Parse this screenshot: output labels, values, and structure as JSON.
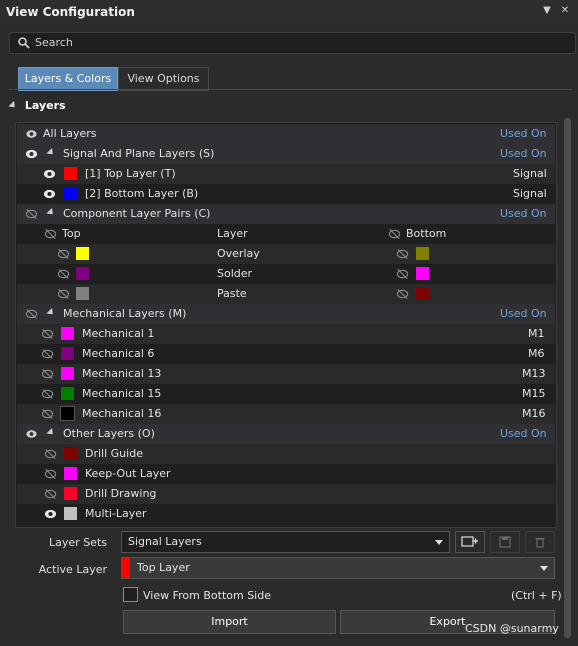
{
  "window": {
    "title": "View Configuration"
  },
  "search": {
    "placeholder": "Search"
  },
  "tabs": [
    {
      "label": "Layers & Colors"
    },
    {
      "label": "View Options"
    }
  ],
  "section": {
    "title": "Layers"
  },
  "groups": {
    "all": {
      "label": "All Layers",
      "status": "Used On"
    },
    "signal": {
      "label": "Signal And Plane Layers (S)",
      "status": "Used On",
      "rows": [
        {
          "name": "[1] Top Layer (T)",
          "value": "Signal",
          "color": "#ff0000"
        },
        {
          "name": "[2] Bottom Layer (B)",
          "value": "Signal",
          "color": "#0000ff"
        }
      ]
    },
    "pairs": {
      "label": "Component Layer Pairs (C)",
      "status": "Used On",
      "col_top": "Top",
      "col_layer": "Layer",
      "col_bottom": "Bottom",
      "rows": [
        {
          "layer": "Overlay",
          "top_color": "#ffff00",
          "bottom_color": "#808000"
        },
        {
          "layer": "Solder",
          "top_color": "#800080",
          "bottom_color": "#ff00ff"
        },
        {
          "layer": "Paste",
          "top_color": "#808080",
          "bottom_color": "#800000"
        }
      ]
    },
    "mech": {
      "label": "Mechanical Layers (M)",
      "status": "Used On",
      "rows": [
        {
          "name": "Mechanical 1",
          "value": "M1",
          "color": "#ff00ff"
        },
        {
          "name": "Mechanical 6",
          "value": "M6",
          "color": "#800080"
        },
        {
          "name": "Mechanical 13",
          "value": "M13",
          "color": "#ff00ff"
        },
        {
          "name": "Mechanical 15",
          "value": "M15",
          "color": "#008000"
        },
        {
          "name": "Mechanical 16",
          "value": "M16",
          "color": "#000000"
        }
      ]
    },
    "other": {
      "label": "Other Layers (O)",
      "status": "Used On",
      "rows": [
        {
          "name": "Drill Guide",
          "color": "#800000",
          "visible": false
        },
        {
          "name": "Keep-Out Layer",
          "color": "#ff00ff",
          "visible": false
        },
        {
          "name": "Drill Drawing",
          "color": "#ff002a",
          "visible": false
        },
        {
          "name": "Multi-Layer",
          "color": "#c0c0c0",
          "visible": true
        }
      ]
    }
  },
  "layer_sets": {
    "label": "Layer Sets",
    "value": "Signal Layers"
  },
  "active_layer": {
    "label": "Active Layer",
    "value": "Top Layer",
    "color": "#ff0000"
  },
  "view_bottom": {
    "label": "View From Bottom Side",
    "shortcut": "(Ctrl + F)"
  },
  "buttons": {
    "import": "Import",
    "export": "Export"
  },
  "watermark": "CSDN @sunarmy"
}
